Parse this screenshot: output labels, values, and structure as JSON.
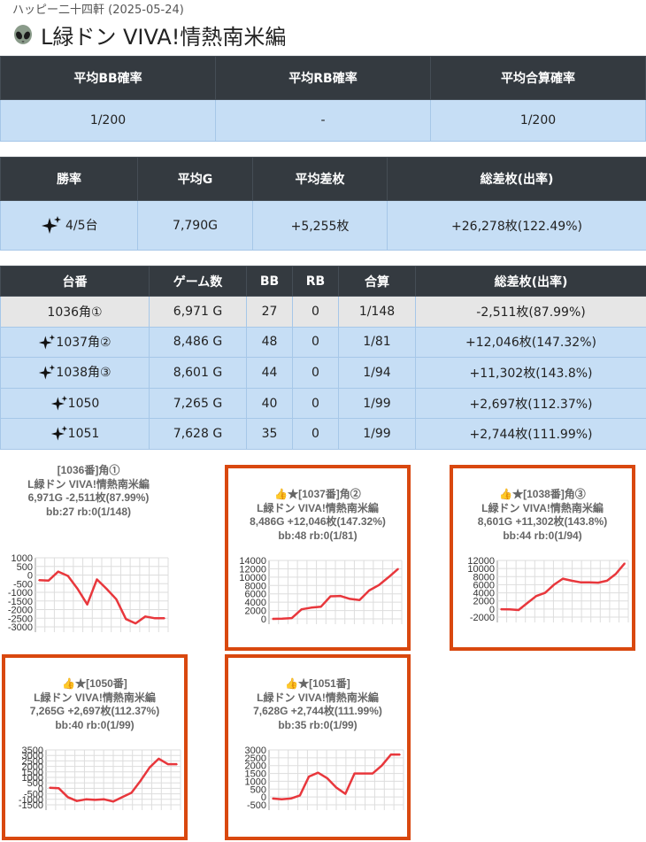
{
  "header": {
    "store_line": "ハッピー二十四軒 (2025-05-24)",
    "machine_title": "L緑ドン VIVA!情熱南米編"
  },
  "summary_rates": {
    "headers": [
      "平均BB確率",
      "平均RB確率",
      "平均合算確率"
    ],
    "values": [
      "1/200",
      "-",
      "1/200"
    ]
  },
  "summary_stats": {
    "headers": [
      "勝率",
      "平均G",
      "平均差枚",
      "総差枚(出率)"
    ],
    "win_rate": "4/5台",
    "avg_games": "7,790G",
    "avg_diff": "+5,255枚",
    "total_diff": "+26,278枚(122.49%)"
  },
  "machines": {
    "headers": [
      "台番",
      "ゲーム数",
      "BB",
      "RB",
      "合算",
      "総差枚(出率)"
    ],
    "rows": [
      {
        "num": "1036角①",
        "games": "6,971 G",
        "bb": "27",
        "rb": "0",
        "total": "1/148",
        "diff": "-2,511枚(87.99%)",
        "star": false
      },
      {
        "num": "1037角②",
        "games": "8,486 G",
        "bb": "48",
        "rb": "0",
        "total": "1/81",
        "diff": "+12,046枚(147.32%)",
        "star": true
      },
      {
        "num": "1038角③",
        "games": "8,601 G",
        "bb": "44",
        "rb": "0",
        "total": "1/94",
        "diff": "+11,302枚(143.8%)",
        "star": true
      },
      {
        "num": "1050",
        "games": "7,265 G",
        "bb": "40",
        "rb": "0",
        "total": "1/99",
        "diff": "+2,697枚(112.37%)",
        "star": true
      },
      {
        "num": "1051",
        "games": "7,628 G",
        "bb": "35",
        "rb": "0",
        "total": "1/99",
        "diff": "+2,744枚(111.99%)",
        "star": true
      }
    ]
  },
  "chart_data": [
    {
      "type": "line",
      "title_lines": [
        "[1036番]角①",
        "L緑ドン VIVA!情熱南米編",
        "6,971G -2,511枚(87.99%)",
        "bb:27 rb:0(1/148)"
      ],
      "yticks": [
        "1000",
        "500",
        "0",
        "-500",
        "-1000",
        "-1500",
        "-2000",
        "-2500",
        "-3000"
      ],
      "ylim": [
        -3000,
        1000
      ],
      "values": [
        -300,
        -320,
        200,
        -50,
        -800,
        -1700,
        -250,
        -800,
        -1400,
        -2550,
        -2800,
        -2400,
        -2500,
        -2500
      ],
      "highlight": false,
      "line_color": "#e8373c"
    },
    {
      "type": "line",
      "title_lines": [
        "👍★[1037番]角②",
        "L緑ドン VIVA!情熱南米編",
        "8,486G +12,046枚(147.32%)",
        "bb:48 rb:0(1/81)"
      ],
      "yticks": [
        "14000",
        "12000",
        "10000",
        "8000",
        "6000",
        "4000",
        "2000",
        "0"
      ],
      "ylim": [
        0,
        14000
      ],
      "values": [
        0,
        50,
        200,
        2300,
        2700,
        2900,
        5400,
        5500,
        4800,
        4500,
        6800,
        8100,
        10000,
        12000
      ],
      "highlight": true,
      "line_color": "#e8373c"
    },
    {
      "type": "line",
      "title_lines": [
        "👍★[1038番]角③",
        "L緑ドン VIVA!情熱南米編",
        "8,601G +11,302枚(143.8%)",
        "bb:44 rb:0(1/94)"
      ],
      "yticks": [
        "12000",
        "10000",
        "8000",
        "6000",
        "4000",
        "2000",
        "0",
        "-2000"
      ],
      "ylim": [
        -2000,
        12000
      ],
      "values": [
        -50,
        -100,
        -250,
        1500,
        3200,
        4000,
        6000,
        7500,
        7000,
        6600,
        6600,
        6500,
        7000,
        8700,
        11300
      ],
      "highlight": true,
      "line_color": "#e8373c"
    },
    {
      "type": "line",
      "title_lines": [
        "👍★[1050番]",
        "L緑ドン VIVA!情熱南米編",
        "7,265G +2,697枚(112.37%)",
        "bb:40 rb:0(1/99)"
      ],
      "yticks": [
        "3500",
        "3000",
        "2500",
        "2000",
        "1500",
        "1000",
        "500",
        "0",
        "-500",
        "-1000",
        "-1500"
      ],
      "ylim": [
        -1500,
        3500
      ],
      "values": [
        50,
        20,
        -800,
        -1150,
        -1000,
        -1050,
        -1000,
        -1200,
        -800,
        -400,
        700,
        1900,
        2700,
        2200,
        2200
      ],
      "highlight": true,
      "line_color": "#e8373c"
    },
    {
      "type": "line",
      "title_lines": [
        "👍★[1051番]",
        "L緑ドン VIVA!情熱南米編",
        "7,628G +2,744枚(111.99%)",
        "bb:35 rb:0(1/99)"
      ],
      "yticks": [
        "3000",
        "2500",
        "2000",
        "1500",
        "1000",
        "500",
        "0",
        "-500"
      ],
      "ylim": [
        -500,
        3000
      ],
      "values": [
        -100,
        -150,
        -100,
        100,
        1300,
        1550,
        1200,
        600,
        200,
        1500,
        1500,
        1500,
        2000,
        2700,
        2700
      ],
      "highlight": true,
      "line_color": "#e8373c"
    }
  ]
}
